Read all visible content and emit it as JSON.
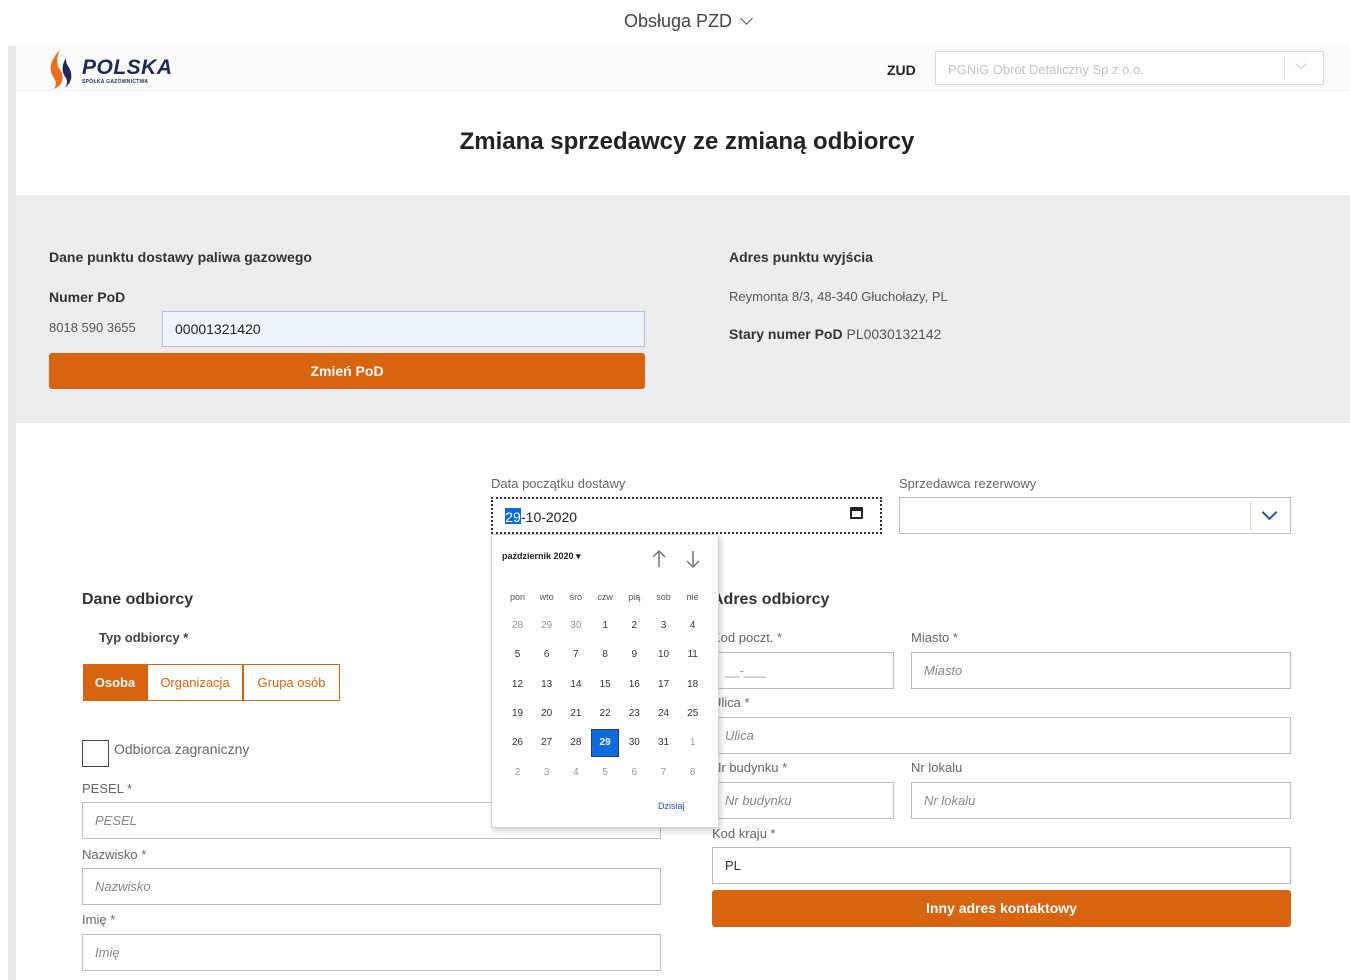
{
  "topbar": {
    "title": "Obsługa PZD"
  },
  "brand": {
    "name": "POLSKA",
    "subtitle": "SPÓŁKA GAZOWNICTWA"
  },
  "zud": {
    "label": "ZUD",
    "value": "PGNiG Obrót Detaliczny Sp z o.o."
  },
  "page": {
    "title": "Zmiana sprzedawcy ze zmianą odbiorcy"
  },
  "pod_section": {
    "heading": "Dane punktu dostawy paliwa gazowego",
    "numer_label": "Numer PoD",
    "prefix": "8018 590 3655",
    "value": "00001321420",
    "change_button": "Zmień PoD"
  },
  "exit_address": {
    "heading": "Adres punktu wyjścia",
    "address": "Reymonta 8/3, 48-340 Głuchołazy, PL",
    "old_pod_label": "Stary numer PoD",
    "old_pod_value": "PL0030132142"
  },
  "delivery": {
    "label": "Data początku dostawy",
    "day": "29",
    "rest": "-10-2020"
  },
  "reserve": {
    "label": "Sprzedawca rezerwowy",
    "value": ""
  },
  "calendar": {
    "month_label": "październik 2020 ▾",
    "weekdays": [
      "pon",
      "wto",
      "śro",
      "czw",
      "pią",
      "sob",
      "nie"
    ],
    "weeks": [
      [
        "28",
        "29",
        "30",
        "1",
        "2",
        "3",
        "4"
      ],
      [
        "5",
        "6",
        "7",
        "8",
        "9",
        "10",
        "11"
      ],
      [
        "12",
        "13",
        "14",
        "15",
        "16",
        "17",
        "18"
      ],
      [
        "19",
        "20",
        "21",
        "22",
        "23",
        "24",
        "25"
      ],
      [
        "26",
        "27",
        "28",
        "29",
        "30",
        "31",
        "1"
      ],
      [
        "2",
        "3",
        "4",
        "5",
        "6",
        "7",
        "8"
      ]
    ],
    "selected": "29",
    "today_label": "Dzisiaj"
  },
  "customer": {
    "heading": "Dane odbiorcy",
    "type_label": "Typ odbiorcy *",
    "types": [
      "Osoba",
      "Organizacja",
      "Grupa osób"
    ],
    "selected_type": "Osoba",
    "foreign_label": "Odbiorca zagraniczny",
    "pesel_label": "PESEL *",
    "pesel_placeholder": "PESEL",
    "surname_label": "Nazwisko *",
    "surname_placeholder": "Nazwisko",
    "name_label": "Imię *",
    "name_placeholder": "Imię"
  },
  "address": {
    "heading": "Adres odbiorcy",
    "postal_label": "Kod poczt. *",
    "postal_value": "__-___",
    "city_label": "Miasto *",
    "city_placeholder": "Miasto",
    "street_label": "Ulica *",
    "street_placeholder": "Ulica",
    "building_label": "Nr budynku *",
    "building_placeholder": "Nr budynku",
    "flat_label": "Nr lokalu",
    "flat_placeholder": "Nr lokalu",
    "country_label": "Kod kraju *",
    "country_value": "PL",
    "other_address_button": "Inny adres kontaktowy"
  },
  "colors": {
    "accent": "#d86410",
    "brand_navy": "#1d2b5a",
    "select_blue": "#0a6ce0"
  }
}
